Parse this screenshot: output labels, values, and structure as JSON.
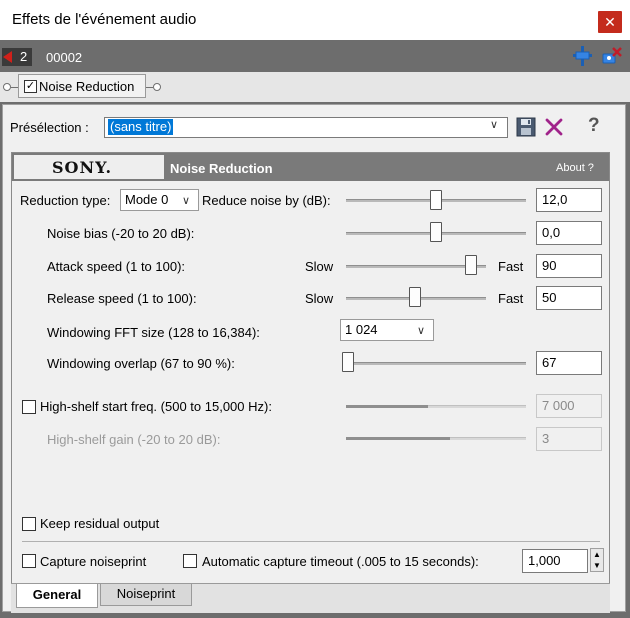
{
  "window": {
    "title": "Effets de l'événement audio",
    "close_glyph": "✕"
  },
  "event": {
    "track_number": "2",
    "name": "00002"
  },
  "chain": {
    "plugin_label": "Noise Reduction",
    "checked": true
  },
  "preset": {
    "label": "Présélection :",
    "value": "(sans titre)"
  },
  "header": {
    "brand": "SONY.",
    "title": "Noise Reduction",
    "about": "About  ?"
  },
  "controls": {
    "reduction_type_label": "Reduction type:",
    "reduction_type_value": "Mode 0",
    "reduce_noise_label": "Reduce noise by (dB):",
    "reduce_noise_value": "12,0",
    "noise_bias_label": "Noise bias (-20 to 20 dB):",
    "noise_bias_value": "0,0",
    "attack_label": "Attack speed (1 to 100):",
    "attack_value": "90",
    "release_label": "Release speed (1 to 100):",
    "release_value": "50",
    "slow_label": "Slow",
    "fast_label": "Fast",
    "fft_label": "Windowing FFT size (128 to 16,384):",
    "fft_value": "1 024",
    "overlap_label": "Windowing overlap (67 to 90 %):",
    "overlap_value": "67",
    "highshelf_freq_label": "High-shelf start freq. (500 to 15,000 Hz):",
    "highshelf_freq_value": "7 000",
    "highshelf_gain_label": "High-shelf gain (-20 to 20 dB):",
    "highshelf_gain_value": "3",
    "keep_residual_label": "Keep residual output",
    "capture_noiseprint_label": "Capture noiseprint",
    "auto_capture_label": "Automatic capture timeout (.005 to 15 seconds):",
    "auto_capture_value": "1,000"
  },
  "tabs": {
    "general": "General",
    "noiseprint": "Noiseprint"
  },
  "icons": {
    "pin": "pin-icon",
    "plugin_chain": "plugin-chain-icon",
    "save": "save-icon",
    "delete": "delete-icon",
    "help": "?",
    "dropdown": "▾"
  },
  "colors": {
    "accent": "#0078d7",
    "close": "#c42b1c",
    "frame": "#6d6d6d",
    "header": "#7a7a7a"
  }
}
